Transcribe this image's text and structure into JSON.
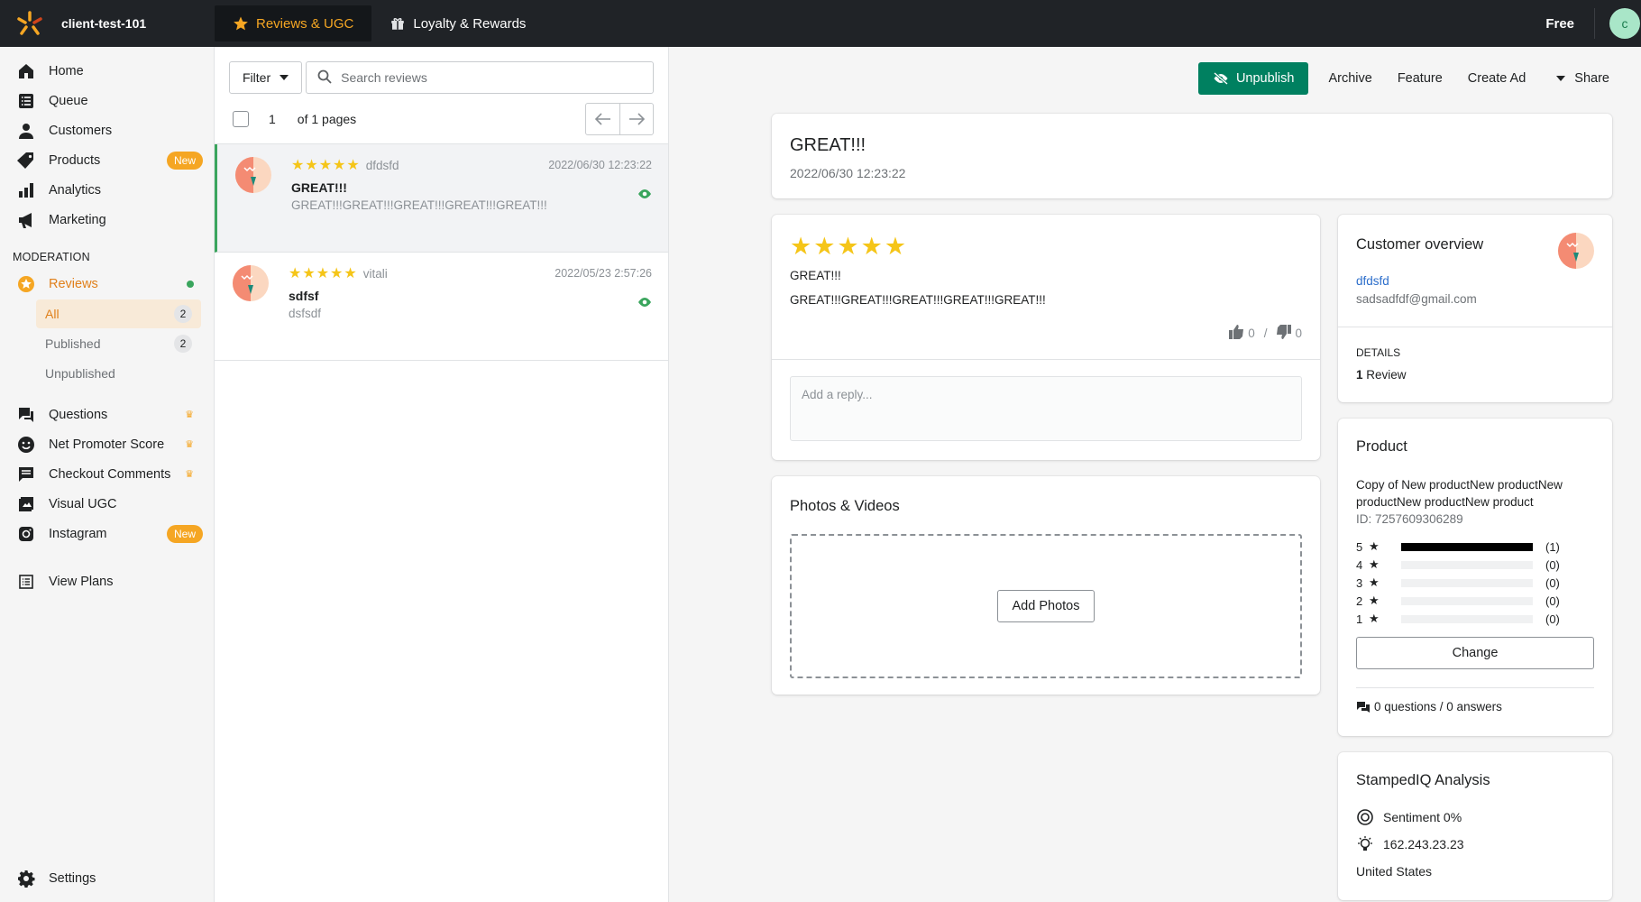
{
  "topbar": {
    "store_name": "client-test-101",
    "tabs": [
      {
        "label": "Reviews & UGC",
        "icon": "star-icon",
        "active": true
      },
      {
        "label": "Loyalty & Rewards",
        "icon": "gift-icon",
        "active": false
      }
    ],
    "plan": "Free",
    "avatar_letter": "c"
  },
  "sidebar": {
    "main_items": [
      {
        "label": "Home",
        "icon": "home-icon"
      },
      {
        "label": "Queue",
        "icon": "list-icon"
      },
      {
        "label": "Customers",
        "icon": "person-icon"
      },
      {
        "label": "Products",
        "icon": "tag-icon",
        "badge": "New"
      },
      {
        "label": "Analytics",
        "icon": "bar-chart-icon"
      },
      {
        "label": "Marketing",
        "icon": "megaphone-icon"
      }
    ],
    "moderation_title": "MODERATION",
    "reviews_label": "Reviews",
    "sub_items": [
      {
        "label": "All",
        "count": "2",
        "active": true
      },
      {
        "label": "Published",
        "count": "2",
        "active": false
      },
      {
        "label": "Unpublished",
        "count": "",
        "active": false
      }
    ],
    "other_items": [
      {
        "label": "Questions",
        "icon": "chat-icon",
        "crown": true
      },
      {
        "label": "Net Promoter Score",
        "icon": "smiley-icon",
        "crown": true
      },
      {
        "label": "Checkout Comments",
        "icon": "comment-icon",
        "crown": true
      },
      {
        "label": "Visual UGC",
        "icon": "image-icon"
      },
      {
        "label": "Instagram",
        "icon": "instagram-icon",
        "badge": "New"
      }
    ],
    "view_plans": "View Plans",
    "settings": "Settings"
  },
  "list": {
    "filter_label": "Filter",
    "search_placeholder": "Search reviews",
    "page_current": "1",
    "page_of": "of 1 pages",
    "reviews": [
      {
        "author": "dfdsfd",
        "date": "2022/06/30 12:23:22",
        "title": "GREAT!!!",
        "body": "GREAT!!!GREAT!!!GREAT!!!GREAT!!!GREAT!!!",
        "rating": 5
      },
      {
        "author": "vitali",
        "date": "2022/05/23 2:57:26",
        "title": "sdfsf",
        "body": "dsfsdf",
        "rating": 5
      }
    ]
  },
  "actions": {
    "unpublish": "Unpublish",
    "archive": "Archive",
    "feature": "Feature",
    "create_ad": "Create Ad",
    "share": "Share"
  },
  "detail": {
    "header_title": "GREAT!!!",
    "header_date": "2022/06/30 12:23:22",
    "stars": "★★★★★",
    "title": "GREAT!!!",
    "body": "GREAT!!!GREAT!!!GREAT!!!GREAT!!!GREAT!!!",
    "votes_up": "0",
    "votes_sep": "/",
    "votes_down": "0",
    "reply_placeholder": "Add a reply...",
    "photos_title": "Photos & Videos",
    "add_photos": "Add Photos"
  },
  "customer": {
    "title": "Customer overview",
    "name": "dfdsfd",
    "email": "sadsadfdf@gmail.com",
    "details_label": "DETAILS",
    "review_count": "1",
    "review_word": "Review"
  },
  "product": {
    "title": "Product",
    "name": "Copy of New productNew productNew productNew productNew product",
    "id_text": "ID: 7257609306289",
    "ratings": [
      {
        "star": "5",
        "count": "(1)",
        "fraction": 1.0
      },
      {
        "star": "4",
        "count": "(0)",
        "fraction": 0
      },
      {
        "star": "3",
        "count": "(0)",
        "fraction": 0
      },
      {
        "star": "2",
        "count": "(0)",
        "fraction": 0
      },
      {
        "star": "1",
        "count": "(0)",
        "fraction": 0
      }
    ],
    "change": "Change",
    "qa_text": "0 questions / 0 answers"
  },
  "stampediq": {
    "title": "StampedIQ Analysis",
    "sentiment": "Sentiment 0%",
    "ip": "162.243.23.23",
    "country": "United States"
  },
  "colors": {
    "accent": "#f5a623",
    "primary_green": "#008060",
    "topbar_bg": "#202327",
    "star": "#f5c518"
  }
}
